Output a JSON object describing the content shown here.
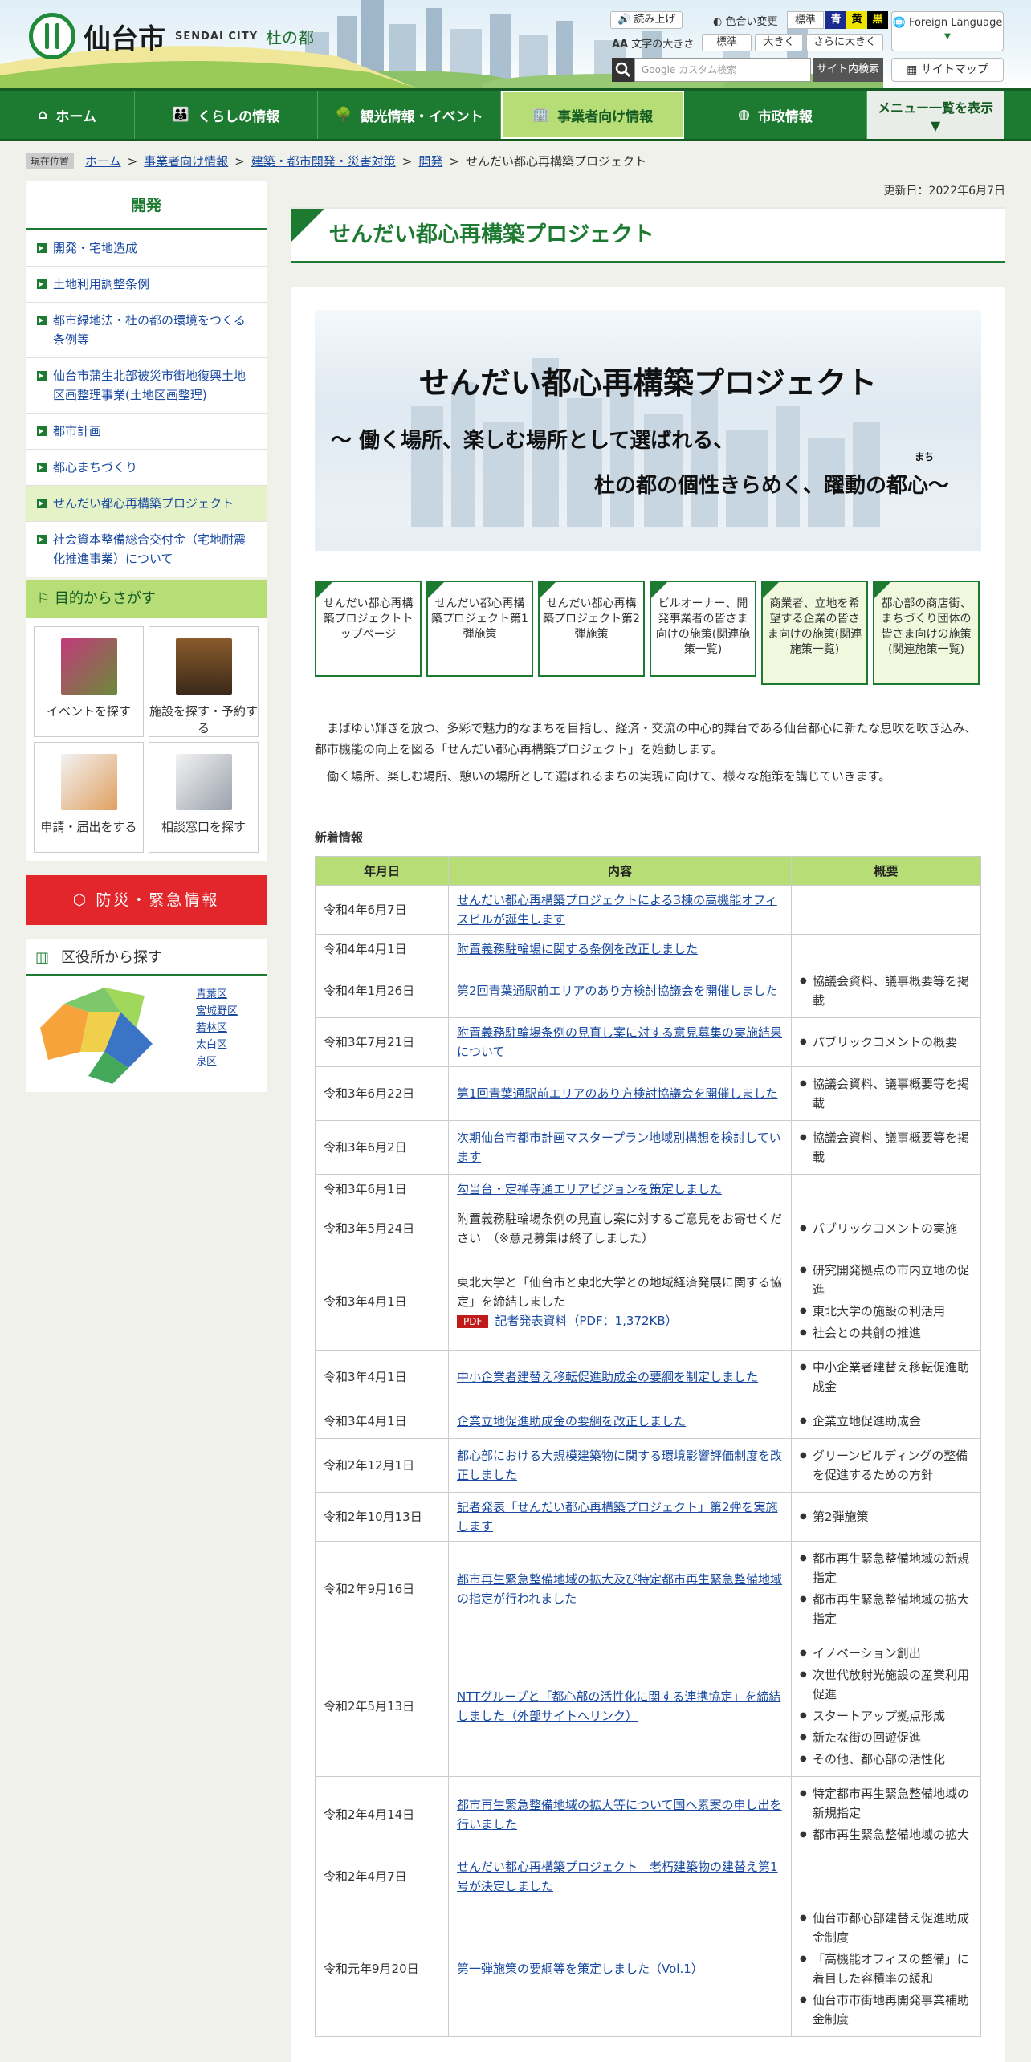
{
  "header": {
    "logo_jp": "仙台市",
    "logo_en": "SENDAI CITY",
    "logo_sub": "杜の都",
    "read_aloud": "読み上げ",
    "color_change": "色合い変更",
    "color_options": [
      "標準",
      "青",
      "黄",
      "黒"
    ],
    "text_size_label": "文字の大きさ",
    "text_size_options": [
      "標準",
      "大きく",
      "さらに大きく"
    ],
    "search_placeholder": "Google カスタム検索",
    "search_button": "サイト内検索",
    "foreign_language": "Foreign Language",
    "sitemap": "サイトマップ"
  },
  "nav": {
    "items": [
      "ホーム",
      "くらしの情報",
      "観光情報・イベント",
      "事業者向け情報",
      "市政情報"
    ],
    "menu_all": "メニュー一覧を表示"
  },
  "breadcrumb": {
    "label": "現在位置",
    "items": [
      "ホーム",
      "事業者向け情報",
      "建築・都市開発・災害対策",
      "開発"
    ],
    "current": "せんだい都心再構築プロジェクト"
  },
  "updated": "更新日：2022年6月7日",
  "sidebar": {
    "title": "開発",
    "items": [
      "開発・宅地造成",
      "土地利用調整条例",
      "都市緑地法・杜の都の環境をつくる条例等",
      "仙台市蒲生北部被災市街地復興土地区画整理事業(土地区画整理)",
      "都市計画",
      "都心まちづくり",
      "せんだい都心再構築プロジェクト",
      "社会資本整備総合交付金（宅地耐震化推進事業）について"
    ],
    "purpose_title": "目的からさがす",
    "purpose": [
      "イベントを探す",
      "施設を探す・予約する",
      "申請・届出をする",
      "相談窓口を探す"
    ],
    "bousai": "防災・緊急情報",
    "ward_title": "区役所から探す",
    "wards": [
      "青葉区",
      "宮城野区",
      "若林区",
      "太白区",
      "泉区"
    ]
  },
  "main": {
    "title": "せんだい都心再構築プロジェクト",
    "banner_title": "せんだい都心再構築プロジェクト",
    "banner_sub1": "～ 働く場所、楽しむ場所として選ばれる、",
    "banner_sub2": "杜の都の個性きらめく、躍動の都心～",
    "banner_ruby": "まち",
    "tiles": [
      "せんだい都心再構築プロジェクトトップページ",
      "せんだい都心再構築プロジェクト第1弾施策",
      "せんだい都心再構築プロジェクト第2弾施策",
      "ビルオーナー、開発事業者の皆さま向けの施策(関連施策一覧)",
      "商業者、立地を希望する企業の皆さま向けの施策(関連施策一覧)",
      "都心部の商店街、まちづくり団体の皆さま向けの施策(関連施策一覧)"
    ],
    "intro1": "まばゆい輝きを放つ、多彩で魅力的なまちを目指し、経済・交流の中心的舞台である仙台都心に新たな息吹を吹き込み、都市機能の向上を図る「せんだい都心再構築プロジェクト」を始動します。",
    "intro2": "働く場所、楽しむ場所、憩いの場所として選ばれるまちの実現に向けて、様々な施策を講じていきます。",
    "news_label": "新着情報",
    "news_headers": [
      "年月日",
      "内容",
      "概要"
    ],
    "news": [
      {
        "date": "令和4年6月7日",
        "content": "せんだい都心再構築プロジェクトによる3棟の高機能オフィスビルが誕生します",
        "link": true,
        "summary": []
      },
      {
        "date": "令和4年4月1日",
        "content": "附置義務駐輪場に関する条例を改正しました",
        "link": true,
        "summary": []
      },
      {
        "date": "令和4年1月26日",
        "content": "第2回青葉通駅前エリアのあり方検討協議会を開催しました",
        "link": true,
        "summary": [
          "協議会資料、議事概要等を掲載"
        ]
      },
      {
        "date": "令和3年7月21日",
        "content": "附置義務駐輪場条例の見直し案に対する意見募集の実施結果について",
        "link": true,
        "summary": [
          "パブリックコメントの概要"
        ]
      },
      {
        "date": "令和3年6月22日",
        "content": "第1回青葉通駅前エリアのあり方検討協議会を開催しました",
        "link": true,
        "summary": [
          "協議会資料、議事概要等を掲載"
        ]
      },
      {
        "date": "令和3年6月2日",
        "content": "次期仙台市都市計画マスタープラン地域別構想を検討しています",
        "link": true,
        "summary": [
          "協議会資料、議事概要等を掲載"
        ]
      },
      {
        "date": "令和3年6月1日",
        "content": "勾当台・定禅寺通エリアビジョンを策定しました",
        "link": true,
        "summary": []
      },
      {
        "date": "令和3年5月24日",
        "content": "附置義務駐輪場条例の見直し案に対するご意見をお寄せください　（※意見募集は終了しました）",
        "link": false,
        "summary": [
          "パブリックコメントの実施"
        ]
      },
      {
        "date": "令和3年4月1日",
        "content": "東北大学と「仙台市と東北大学との地域経済発展に関する協定」を締結しました",
        "link": false,
        "pdf": "PDF",
        "pdf_link": "記者発表資料（PDF：1,372KB）",
        "summary": [
          "研究開発拠点の市内立地の促進",
          "東北大学の施設の利活用",
          "社会との共創の推進"
        ]
      },
      {
        "date": "令和3年4月1日",
        "content": "中小企業者建替え移転促進助成金の要綱を制定しました",
        "link": true,
        "summary": [
          "中小企業者建替え移転促進助成金"
        ]
      },
      {
        "date": "令和3年4月1日",
        "content": "企業立地促進助成金の要綱を改正しました",
        "link": true,
        "summary": [
          "企業立地促進助成金"
        ]
      },
      {
        "date": "令和2年12月1日",
        "content": "都心部における大規模建築物に関する環境影響評価制度を改正しました",
        "link": true,
        "summary": [
          "グリーンビルディングの整備を促進するための方針"
        ]
      },
      {
        "date": "令和2年10月13日",
        "content": "記者発表「せんだい都心再構築プロジェクト」第2弾を実施します",
        "link": true,
        "summary": [
          "第2弾施策"
        ]
      },
      {
        "date": "令和2年9月16日",
        "content": "都市再生緊急整備地域の拡大及び特定都市再生緊急整備地域の指定が行われました",
        "link": true,
        "summary": [
          "都市再生緊急整備地域の新規指定",
          "都市再生緊急整備地域の拡大指定"
        ]
      },
      {
        "date": "令和2年5月13日",
        "content": "NTTグループと「都心部の活性化に関する連携協定」を締結しました（外部サイトへリンク）",
        "link": true,
        "summary": [
          "イノベーション創出",
          "次世代放射光施設の産業利用促進",
          "スタートアップ拠点形成",
          "新たな街の回遊促進",
          "その他、都心部の活性化"
        ]
      },
      {
        "date": "令和2年4月14日",
        "content": "都市再生緊急整備地域の拡大等について国へ素案の申し出を行いました",
        "link": true,
        "summary": [
          "特定都市再生緊急整備地域の新規指定",
          "都市再生緊急整備地域の拡大"
        ]
      },
      {
        "date": "令和2年4月7日",
        "content": "せんだい都心再構築プロジェクト　老朽建築物の建替え第1号が決定しました",
        "link": true,
        "summary": []
      },
      {
        "date": "令和元年9月20日",
        "content": "第一弾施策の要綱等を策定しました（Vol.1）",
        "link": true,
        "summary": [
          "仙台市都心部建替え促進助成金制度",
          "「高機能オフィスの整備」に着目した容積率の緩和",
          "仙台市市街地再開発事業補助金制度"
        ]
      }
    ]
  }
}
